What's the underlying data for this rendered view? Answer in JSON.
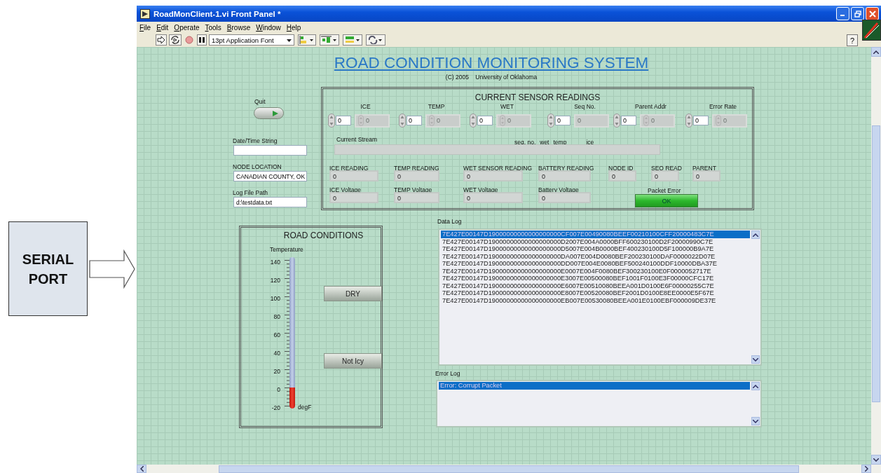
{
  "source": {
    "label": "SERIAL\nPORT"
  },
  "window": {
    "title": "RoadMonClient-1.vi Front Panel *"
  },
  "menu": [
    "File",
    "Edit",
    "Operate",
    "Tools",
    "Browse",
    "Window",
    "Help"
  ],
  "toolbar": {
    "font": "13pt Application Font",
    "help": "?"
  },
  "header": {
    "title": "ROAD CONDITION MONITORING SYSTEM",
    "subtitle": "(C) 2005    University of Oklahoma"
  },
  "quit": {
    "label": "Quit"
  },
  "fields": [
    {
      "label": "Date/Time String"
    },
    {
      "label": "NODE LOCATION",
      "value": "CANADIAN COUNTY, OK"
    },
    {
      "label": "Log File Path",
      "value": "d:\\testdata.txt"
    }
  ],
  "sensor_panel": {
    "title": "CURRENT SENSOR READINGS",
    "controls": [
      {
        "label": "ICE",
        "value": "0",
        "indicator": "0",
        "indicator_stepper": true
      },
      {
        "label": "TEMP",
        "value": "0",
        "indicator": "0",
        "indicator_stepper": true
      },
      {
        "label": "WET",
        "value": "0",
        "indicator": "0",
        "indicator_stepper": true
      },
      {
        "label": "Seq No.",
        "value": "0",
        "indicator": "0",
        "indicator_stepper": false
      },
      {
        "label": "Parent Addr",
        "value": "0",
        "indicator": "0",
        "indicator_stepper": true
      },
      {
        "label": "Error Rate",
        "value": "0",
        "indicator": "0",
        "indicator_stepper": true
      }
    ],
    "stream": {
      "label": "Current Stream",
      "legend": [
        "seq. no.",
        "wet",
        "temp",
        "ice"
      ]
    },
    "readings": [
      {
        "label": "ICE READING",
        "value": "0"
      },
      {
        "label": "TEMP READING",
        "value": "0"
      },
      {
        "label": "WET SENSOR READING",
        "value": "0"
      },
      {
        "label": "BATTERY READING",
        "value": "0"
      },
      {
        "label": "NODE ID",
        "value": "0"
      },
      {
        "label": "SEQ READ",
        "value": "0"
      },
      {
        "label": "PARENT",
        "value": "0"
      },
      {
        "label": "ICE Voltage",
        "value": "0"
      },
      {
        "label": "TEMP Voltage",
        "value": "0"
      },
      {
        "label": "WET Voltage",
        "value": "0"
      },
      {
        "label": "Battery Voltage",
        "value": "0"
      }
    ],
    "packet_error": {
      "label": "Packet Error",
      "value": "OK",
      "on": true
    }
  },
  "road_conditions": {
    "title": "ROAD CONDITIONS",
    "thermometer": {
      "label": "Temperature",
      "unit": "degF",
      "ticks": [
        "140",
        "120",
        "100",
        "80",
        "60",
        "40",
        "20",
        "0",
        "-20"
      ],
      "level": 0.125
    },
    "indicators": [
      "DRY",
      "Not Icy"
    ]
  },
  "data_log": {
    "label": "Data Log",
    "rows": [
      {
        "text": "7E427E00147D19000000000000000000CF007E00490080BEEF00210100CFF20000483C7E",
        "selected": true
      },
      {
        "text": "7E427E00147D19000000000000000000D2007E004A0000BFF600230100D2F20000990C7E",
        "selected": false
      },
      {
        "text": "7E427E00147D19000000000000000000D5007E004B0000BEF400230100D5F100000B9A7E",
        "selected": false
      },
      {
        "text": "7E427E00147D19000000000000000000DA007E004D0080BEF200230100DAF0000022D07E",
        "selected": false
      },
      {
        "text": "7E427E00147D19000000000000000000DD007E004E0080BEF500240100DDF10000DBA37E",
        "selected": false
      },
      {
        "text": "7E427E00147D19000000000000000000E0007E004F0080BEF300230100E0F0000052717E",
        "selected": false
      },
      {
        "text": "7E427E00147D19000000000000000000E3007E00500080BEF1001F0100E3F00000CFC17E",
        "selected": false
      },
      {
        "text": "7E427E00147D19000000000000000000E6007E00510080BEEA001D0100E6F00000255C7E",
        "selected": false
      },
      {
        "text": "7E427E00147D19000000000000000000E8007E00520080BEF2001D0100E8EE0000E5F67E",
        "selected": false
      },
      {
        "text": "7E427E00147D19000000000000000000EB007E00530080BEEA001E0100EBF000009DE37E",
        "selected": false
      }
    ]
  },
  "error_log": {
    "label": "Error Log",
    "rows": [
      {
        "text": "Error:  Corrupt Packet",
        "selected": true
      }
    ]
  }
}
